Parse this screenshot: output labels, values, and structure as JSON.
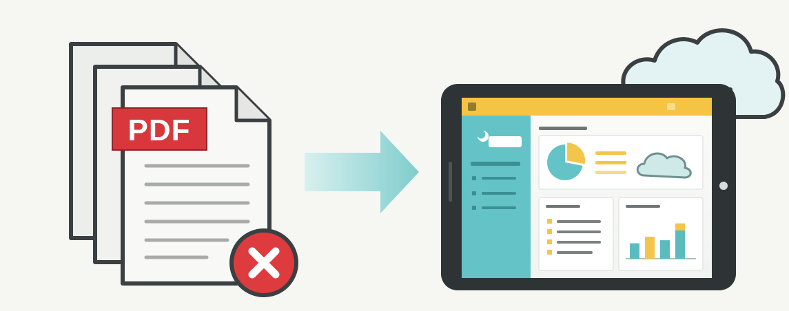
{
  "documents": {
    "badge_text": "PDF",
    "badge_color": "#d8383c",
    "status": "error",
    "status_icon": "close-icon",
    "status_color": "#de3b3f"
  },
  "arrow": {
    "icon": "arrow-right-icon",
    "color": "#8fd4d4"
  },
  "cloud": {
    "icon": "cloud-icon",
    "fill": "#e3f2f2"
  },
  "tablet": {
    "frame_color": "#2e3436",
    "topbar_color": "#f5c443",
    "sidebar_color": "#63c3c6",
    "dashboard_widgets": [
      "pie-chart",
      "cloud",
      "list",
      "bar-chart"
    ],
    "bar_chart": {
      "type": "bar",
      "values": [
        0.35,
        0.5,
        0.42,
        0.8
      ],
      "colors": [
        "#5bbcbf",
        "#f3c64b",
        "#5bbcbf",
        "#5bbcbf"
      ]
    },
    "pie_chart": {
      "type": "pie",
      "slices": [
        0.28,
        0.72
      ],
      "colors": [
        "#f3c64b",
        "#63c3c6"
      ]
    }
  }
}
